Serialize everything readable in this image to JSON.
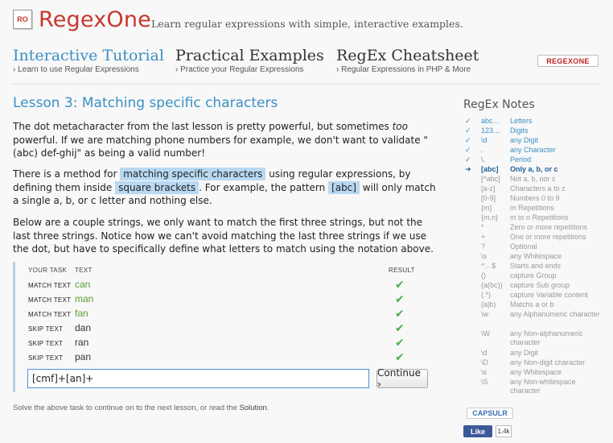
{
  "header": {
    "logo_mark": "RO",
    "logo_text": "RegexOne",
    "tagline": "Learn regular expressions with simple, interactive examples."
  },
  "nav": [
    {
      "title": "Interactive Tutorial",
      "subtitle": "› Learn to use Regular Expressions",
      "active": true
    },
    {
      "title": "Practical Examples",
      "subtitle": "› Practice your Regular Expressions",
      "active": false
    },
    {
      "title": "RegEx Cheatsheet",
      "subtitle": "› Regular Expressions in PHP & More",
      "active": false
    }
  ],
  "brand_badge": "REGEXONE",
  "lesson": {
    "title": "Lesson 3: Matching specific characters",
    "p1_a": "The dot metacharacter from the last lesson is pretty powerful, but sometimes ",
    "p1_em": "too",
    "p1_b": " powerful. If we are matching phone numbers for example, we don't want to validate \"(abc) def-ghij\" as being a valid number!",
    "p2_a": "There is a method for ",
    "p2_hl1": "matching specific characters",
    "p2_b": " using regular expressions, by defining them inside ",
    "p2_hl2": "square brackets",
    "p2_c": ". For example, the pattern ",
    "p2_hl3": "[abc]",
    "p2_d": " will only match a single a, b, or c letter and nothing else.",
    "p3": "Below are a couple strings, we only want to match the first three strings, but not the last three strings. Notice how we can't avoid matching the last three strings if we use the dot, but have to specifically define what letters to match using the notation above."
  },
  "task": {
    "headers": {
      "task": "YOUR TASK",
      "text": "TEXT",
      "result": "RESULT"
    },
    "rows": [
      {
        "kind": "MATCH TEXT",
        "text": "can",
        "match": true,
        "result": "✔"
      },
      {
        "kind": "MATCH TEXT",
        "text": "man",
        "match": true,
        "result": "✔"
      },
      {
        "kind": "MATCH TEXT",
        "text": "fan",
        "match": true,
        "result": "✔"
      },
      {
        "kind": "SKIP TEXT",
        "text": "dan",
        "match": false,
        "result": "✔"
      },
      {
        "kind": "SKIP TEXT",
        "text": "ran",
        "match": false,
        "result": "✔"
      },
      {
        "kind": "SKIP TEXT",
        "text": "pan",
        "match": false,
        "result": "✔"
      }
    ],
    "input_value": "[cmf]+[an]+",
    "continue_label": "Continue ›"
  },
  "footnote": {
    "prefix": "Solve the above task to continue on to the next lesson, or read the ",
    "link": "Solution",
    "suffix": "."
  },
  "notes": {
    "title": "RegEx Notes",
    "items": [
      {
        "mark": "✓",
        "pattern": "abc…",
        "desc": "Letters",
        "state": "done"
      },
      {
        "mark": "✓",
        "pattern": "123…",
        "desc": "Digits",
        "state": "done"
      },
      {
        "mark": "✓",
        "pattern": "\\d",
        "desc": "any Digit",
        "state": "done"
      },
      {
        "mark": "✓",
        "pattern": ".",
        "desc": "any Character",
        "state": "done"
      },
      {
        "mark": "✓",
        "pattern": "\\.",
        "desc": "Period",
        "state": "done"
      },
      {
        "mark": "➜",
        "pattern": "[abc]",
        "desc": "Only a, b, or c",
        "state": "current"
      },
      {
        "mark": "",
        "pattern": "[^abc]",
        "desc": "Not a, b, nor c",
        "state": "todo"
      },
      {
        "mark": "",
        "pattern": "[a-z]",
        "desc": "Characters a to z",
        "state": "todo"
      },
      {
        "mark": "",
        "pattern": "[0-9]",
        "desc": "Numbers 0 to 9",
        "state": "todo"
      },
      {
        "mark": "",
        "pattern": "{m}",
        "desc": "m Repetitions",
        "state": "todo"
      },
      {
        "mark": "",
        "pattern": "{m,n}",
        "desc": "m to n Repetitions",
        "state": "todo"
      },
      {
        "mark": "",
        "pattern": "*",
        "desc": "Zero or more repetitions",
        "state": "todo"
      },
      {
        "mark": "",
        "pattern": "+",
        "desc": "One or more repetitions",
        "state": "todo"
      },
      {
        "mark": "",
        "pattern": "?",
        "desc": "Optional",
        "state": "todo"
      },
      {
        "mark": "",
        "pattern": "\\s",
        "desc": "any Whitespace",
        "state": "todo"
      },
      {
        "mark": "",
        "pattern": "^…$",
        "desc": "Starts and ends",
        "state": "todo"
      },
      {
        "mark": "",
        "pattern": "()",
        "desc": "capture Group",
        "state": "todo"
      },
      {
        "mark": "",
        "pattern": "(a(bc))",
        "desc": "capture Sub group",
        "state": "todo"
      },
      {
        "mark": "",
        "pattern": "(.*)",
        "desc": "capture Variable content",
        "state": "todo"
      },
      {
        "mark": "",
        "pattern": "(a|b)",
        "desc": "Matchs a or b",
        "state": "todo"
      },
      {
        "mark": "",
        "pattern": "\\w",
        "desc": "any Alphanumeric character",
        "state": "todo"
      },
      {
        "mark": "",
        "pattern": "\\W",
        "desc": "any Non-alphanumeric character",
        "state": "todo"
      },
      {
        "mark": "",
        "pattern": "\\d",
        "desc": "any Digit",
        "state": "todo"
      },
      {
        "mark": "",
        "pattern": "\\D",
        "desc": "any Non-digit character",
        "state": "todo"
      },
      {
        "mark": "",
        "pattern": "\\s",
        "desc": "any Whitespace",
        "state": "todo"
      },
      {
        "mark": "",
        "pattern": "\\S",
        "desc": "any Non-whitespace character",
        "state": "todo"
      }
    ]
  },
  "social": {
    "capsulr": "CAPSULR",
    "fb_like": "Like",
    "fb_count": "1.4k"
  },
  "colors": {
    "accent": "#3b8fc4",
    "brand": "#c8372d",
    "highlight": "#b9d9f2",
    "match_green": "#5a9e2f",
    "check_green": "#4caf50"
  }
}
